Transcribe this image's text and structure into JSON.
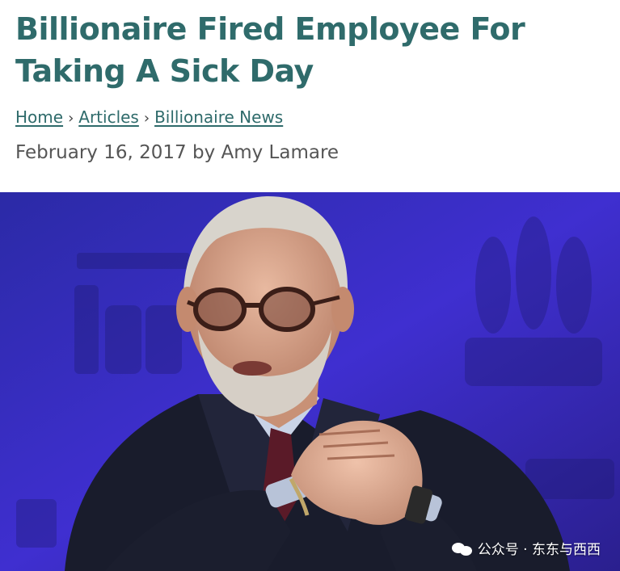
{
  "article": {
    "title": "Billionaire Fired Employee For Taking A Sick Day",
    "breadcrumb": [
      {
        "label": "Home"
      },
      {
        "label": "Articles"
      },
      {
        "label": "Billionaire News"
      }
    ],
    "breadcrumb_separator": "›",
    "date": "February 16, 2017",
    "by_word": "by",
    "author": "Amy Lamare"
  },
  "photo": {
    "watermark": "公众号 · 东东与西西"
  },
  "colors": {
    "title": "#2f6b6b",
    "link": "#2f6b6b",
    "byline": "#555555",
    "photo_background": "#3a2fc0"
  }
}
